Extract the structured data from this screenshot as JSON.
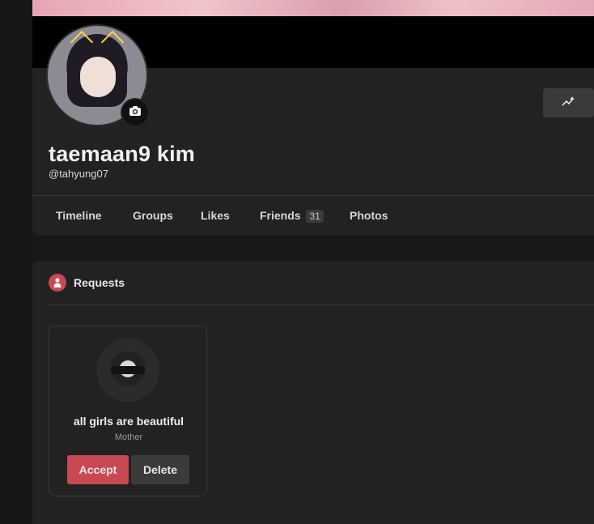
{
  "profile": {
    "name": "taemaan9 kim",
    "handle": "@tahyung07"
  },
  "tabs": [
    {
      "label": "Timeline"
    },
    {
      "label": "Groups"
    },
    {
      "label": "Likes"
    },
    {
      "label": "Friends",
      "count": "31"
    },
    {
      "label": "Photos"
    }
  ],
  "requests": {
    "title": "Requests",
    "items": [
      {
        "name": "all girls are beautiful",
        "relation": "Mother",
        "accept_label": "Accept",
        "delete_label": "Delete"
      }
    ]
  },
  "icons": {
    "camera": "camera-icon",
    "action": "sparkle-chart-icon",
    "requests": "person-request-icon"
  },
  "colors": {
    "accent": "#c94953",
    "background": "#181818",
    "card": "#222222"
  }
}
